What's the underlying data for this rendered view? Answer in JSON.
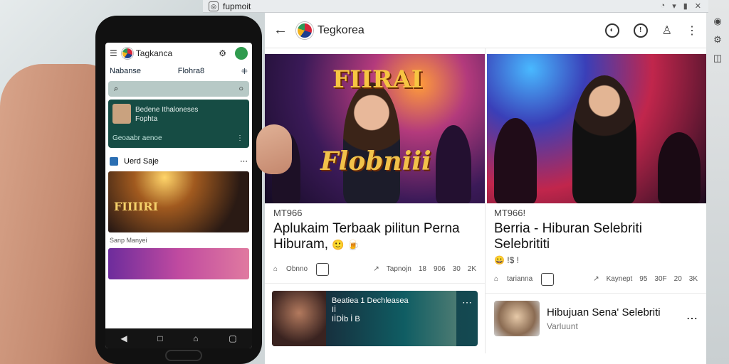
{
  "window": {
    "title": "fupmoit",
    "tab_icon": "globe-icon",
    "status_icons": [
      "wifi-icon",
      "signal-icon",
      "battery-icon",
      "close-icon"
    ]
  },
  "app": {
    "title": "Tegkorea",
    "actions": [
      "notification-icon",
      "info-icon",
      "profile-icon",
      "more-vert-icon"
    ],
    "posts": [
      {
        "image_title": "FIIRAI",
        "image_subtitle": "Flobniii",
        "meta": "MT966",
        "title": "Aplukaim Terbaak pilitun Perna Hiburam,",
        "emoji": "🙂 🍺",
        "stats": {
          "left_label": "Obnno",
          "share": "Tapnojn",
          "c1": "18",
          "c1b": "906",
          "c2": "30",
          "c2b": "2K"
        }
      },
      {
        "meta": "MT966!",
        "title": "Berria - Hiburan Selebriti Selebrititi",
        "emoji": "😀 !$ !",
        "stats": {
          "left_label": "tarianna",
          "share": "Kaynept",
          "c1": "95",
          "c1b": "30F",
          "c2": "20",
          "c2b": "3K"
        }
      }
    ],
    "mini_card": {
      "title": "Beatiea 1 Dechleasea",
      "line2": "Iİ",
      "line3": "IİDİb İ B"
    },
    "list_item": {
      "title": "Hibujuan Sena' Selebriti",
      "subtitle": "Varluunt"
    }
  },
  "phone": {
    "title": "Tagkanca",
    "tabs": [
      "Nabanse",
      "Flohra8"
    ],
    "featured": {
      "line1": "Bedene Ithaloneses",
      "line2": "Fophta",
      "caption": "Geoaabr aenoe"
    },
    "section_label": "Uerd Saje",
    "image_title": "FIIIIRI",
    "caption": "Sanp Manyei"
  },
  "colors": {
    "accent_green": "#2f9b4e",
    "featured_bg": "#164c44"
  }
}
